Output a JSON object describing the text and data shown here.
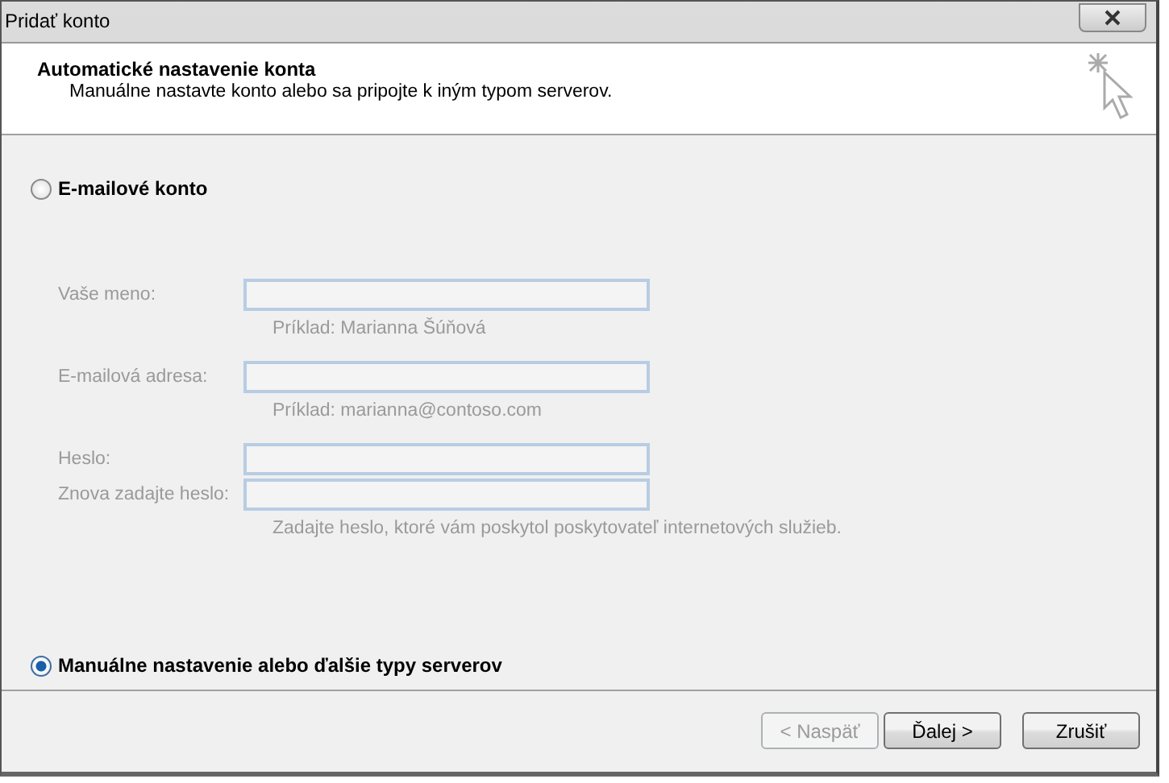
{
  "window": {
    "title": "Pridať konto"
  },
  "header": {
    "title": "Automatické nastavenie konta",
    "subtitle": "Manuálne nastavte konto alebo sa pripojte k iným typom serverov."
  },
  "options": [
    {
      "label": "E-mailové konto",
      "selected": false
    },
    {
      "label": "Manuálne nastavenie alebo ďalšie typy serverov",
      "selected": true
    }
  ],
  "fields": [
    {
      "label": "Vaše meno:",
      "hint": "Príklad: Marianna Šúňová",
      "disabled": true
    },
    {
      "label": "E-mailová adresa:",
      "hint": "Príklad: marianna@contoso.com",
      "disabled": true
    },
    {
      "label": "Heslo:",
      "disabled": true
    },
    {
      "label": "Znova zadajte heslo:",
      "hint": "Zadajte heslo, ktoré vám poskytol poskytovateľ internetových služieb.",
      "disabled": true
    }
  ],
  "buttons": [
    {
      "label": "< Naspäť",
      "disabled": true
    },
    {
      "label": "Ďalej >",
      "disabled": false
    },
    {
      "label": "Zrušiť",
      "disabled": false
    }
  ]
}
